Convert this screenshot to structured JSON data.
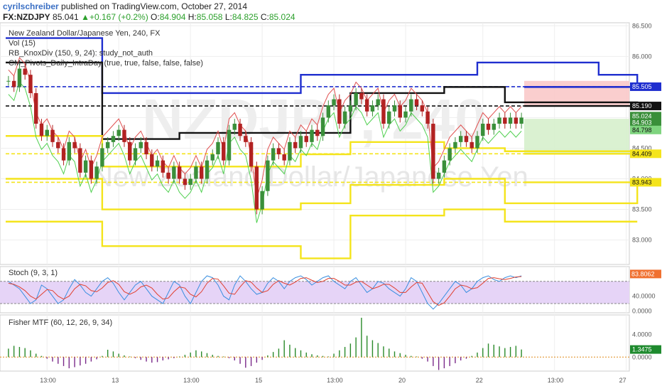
{
  "header": {
    "author": "cyrilschreiber",
    "published": " published on TradingView.com, October 27, 2014",
    "symbol": "FX:NZDJPY",
    "last": "85.041",
    "change_arrow": "▲",
    "change": "+0.167 (+0.2%)",
    "open_label": "O:",
    "open": "84.904",
    "high_label": "H:",
    "high": "85.058",
    "low_label": "L:",
    "low": "84.825",
    "close_label": "C:",
    "close": "85.024"
  },
  "colors": {
    "up": "#3a8f3a",
    "down": "#b22222",
    "pivot_r": "#1f2ecf",
    "pivot_p": "#111111",
    "pivot_s": "#f4e41b",
    "stoch_k": "#3a8fe0",
    "stoch_d": "#e04030",
    "stoch_band": "#e6d4f7",
    "fisher": "#2a8a2a",
    "fisher_neg": "#7a2a8a",
    "fisher_zero": "#e08a1a",
    "zone_red": "#f9c9c9",
    "zone_green": "#d6f0cc"
  },
  "chart_data": [
    {
      "type": "candlestick",
      "title": "New Zealand Dollar/Japanese Yen, 240, FX",
      "watermark_symbol": "NZDJPY, 240",
      "watermark_name": "New Zealand Dollar/Japanese Yen",
      "indicators": [
        "Vol (15)",
        "RB_KnoxDiv (150, 9, 24): study_not_auth",
        "CM_Pivots_Daily_IntraDay (true, true, false, false, false)"
      ],
      "ylim": [
        82.6,
        86.55
      ],
      "yticks": [
        "86.500",
        "86.000",
        "85.500",
        "85.000",
        "84.500",
        "84.000",
        "83.500",
        "83.000"
      ],
      "ytick_values": [
        86.5,
        86.0,
        85.5,
        85.0,
        84.5,
        84.0,
        83.5,
        83.0
      ],
      "xticks": [
        "13:00",
        "13",
        "13:00",
        "15",
        "13:00",
        "20",
        "22",
        "13:00",
        "27"
      ],
      "xtick_bars": [
        7,
        20,
        33,
        46,
        59,
        72,
        86,
        99,
        112
      ],
      "price_tags": [
        {
          "label": "85.505",
          "value": 85.505,
          "bg": "#1f2ecf",
          "fg": "#ffffff"
        },
        {
          "label": "85.190",
          "value": 85.19,
          "bg": "#111111",
          "fg": "#ffffff"
        },
        {
          "label": "85.024",
          "value": 85.024,
          "bg": "#3a8f3a",
          "fg": "#ffffff"
        },
        {
          "label": "84.903",
          "value": 84.92,
          "bg": "#3a8f3a",
          "fg": "#ffffff"
        },
        {
          "label": "84.798",
          "value": 84.798,
          "bg": "#7fd47f",
          "fg": "#111111"
        },
        {
          "label": "84.409",
          "value": 84.409,
          "bg": "#f4e41b",
          "fg": "#111111"
        },
        {
          "label": "83.943",
          "value": 83.943,
          "bg": "#f4e41b",
          "fg": "#111111"
        }
      ],
      "closes": [
        85.6,
        85.5,
        85.8,
        85.7,
        85.4,
        84.9,
        84.7,
        84.8,
        84.6,
        84.5,
        84.3,
        84.6,
        84.5,
        84.1,
        84.3,
        84.0,
        84.2,
        84.5,
        84.6,
        84.7,
        84.8,
        84.6,
        84.3,
        84.5,
        84.6,
        84.4,
        84.2,
        84.3,
        84.1,
        84.0,
        84.2,
        84.0,
        83.9,
        84.0,
        84.2,
        84.0,
        84.3,
        84.4,
        84.6,
        84.3,
        84.8,
        84.9,
        84.7,
        84.6,
        84.2,
        83.5,
        83.8,
        84.3,
        84.5,
        84.4,
        84.3,
        84.6,
        84.5,
        84.7,
        84.6,
        84.8,
        84.7,
        85.0,
        85.2,
        85.3,
        84.9,
        85.1,
        85.2,
        85.4,
        85.3,
        85.1,
        85.2,
        85.3,
        84.9,
        85.1,
        85.2,
        85.0,
        85.1,
        85.3,
        85.2,
        85.1,
        84.9,
        84.0,
        84.1,
        84.3,
        84.5,
        84.6,
        84.7,
        84.6,
        84.5,
        84.7,
        84.9,
        84.8,
        84.9,
        85.0,
        84.9,
        85.0,
        84.9,
        85.0
      ],
      "pivot_lines": [
        {
          "name": "R1",
          "style": "solid",
          "color": "#1f2ecf",
          "steps": [
            [
              0,
              86.3
            ],
            [
              17,
              85.4
            ],
            [
              31,
              85.4
            ],
            [
              53,
              85.7
            ],
            [
              73,
              85.7
            ],
            [
              85,
              85.9
            ],
            [
              107,
              85.7
            ],
            [
              114,
              85.5
            ]
          ]
        },
        {
          "name": "R1 dashed",
          "style": "dashed",
          "color": "#1f2ecf",
          "steps": [
            [
              0,
              85.505
            ],
            [
              114,
              85.505
            ]
          ]
        },
        {
          "name": "P",
          "style": "solid",
          "color": "#111111",
          "steps": [
            [
              0,
              85.9
            ],
            [
              17,
              84.65
            ],
            [
              31,
              84.75
            ],
            [
              53,
              84.75
            ],
            [
              62,
              85.4
            ],
            [
              73,
              85.4
            ],
            [
              79,
              85.5
            ],
            [
              90,
              85.25
            ],
            [
              107,
              85.25
            ],
            [
              114,
              85.19
            ]
          ]
        },
        {
          "name": "P dashed",
          "style": "dashed",
          "color": "#111111",
          "steps": [
            [
              0,
              85.19
            ],
            [
              114,
              85.19
            ]
          ]
        },
        {
          "name": "S1",
          "style": "solid",
          "color": "#f4e41b",
          "steps": [
            [
              0,
              84.7
            ],
            [
              17,
              84.2
            ],
            [
              31,
              84.2
            ],
            [
              53,
              84.4
            ],
            [
              62,
              84.6
            ],
            [
              73,
              84.6
            ],
            [
              79,
              84.5
            ],
            [
              90,
              84.45
            ],
            [
              107,
              84.45
            ],
            [
              114,
              84.409
            ]
          ]
        },
        {
          "name": "S1 dashed",
          "style": "dashed",
          "color": "#f4e41b",
          "steps": [
            [
              0,
              84.409
            ],
            [
              114,
              84.409
            ]
          ]
        },
        {
          "name": "S2",
          "style": "solid",
          "color": "#f4e41b",
          "steps": [
            [
              0,
              84.0
            ],
            [
              17,
              83.5
            ],
            [
              31,
              83.5
            ],
            [
              53,
              83.6
            ],
            [
              62,
              83.9
            ],
            [
              73,
              83.9
            ],
            [
              79,
              84.0
            ],
            [
              90,
              83.6
            ],
            [
              107,
              83.6
            ],
            [
              114,
              83.943
            ]
          ]
        },
        {
          "name": "S2 dashed",
          "style": "dashed",
          "color": "#f4e41b",
          "steps": [
            [
              0,
              83.943
            ],
            [
              114,
              83.943
            ]
          ]
        },
        {
          "name": "S3",
          "style": "solid",
          "color": "#f4e41b",
          "steps": [
            [
              0,
              83.3
            ],
            [
              17,
              82.9
            ],
            [
              31,
              82.9
            ],
            [
              53,
              82.7
            ],
            [
              62,
              83.4
            ],
            [
              73,
              83.4
            ],
            [
              79,
              83.5
            ],
            [
              90,
              83.3
            ],
            [
              107,
              83.3
            ],
            [
              114,
              83.3
            ]
          ]
        }
      ]
    },
    {
      "type": "line",
      "title": "Stoch (9, 3, 1)",
      "ylim": [
        -5,
        120
      ],
      "yticks": [
        "40.0000",
        "0.0000"
      ],
      "ytick_values": [
        40,
        0
      ],
      "band": [
        20,
        80
      ],
      "tag": {
        "label": "83.8062",
        "value": 83.8062
      },
      "series": [
        {
          "name": "%K",
          "values": [
            80,
            70,
            60,
            40,
            20,
            30,
            70,
            60,
            40,
            20,
            30,
            60,
            85,
            70,
            50,
            40,
            60,
            80,
            90,
            75,
            50,
            30,
            50,
            70,
            80,
            60,
            40,
            30,
            20,
            50,
            80,
            70,
            40,
            20,
            50,
            80,
            95,
            90,
            70,
            40,
            30,
            70,
            95,
            80,
            60,
            45,
            50,
            75,
            90,
            80,
            60,
            80,
            90,
            95,
            85,
            70,
            80,
            90,
            95,
            80,
            70,
            60,
            80,
            90,
            70,
            50,
            60,
            80,
            75,
            60,
            50,
            40,
            60,
            90,
            80,
            50,
            20,
            5,
            20,
            40,
            60,
            80,
            70,
            50,
            60,
            80,
            90,
            95,
            85,
            80,
            90,
            95,
            90,
            95
          ]
        },
        {
          "name": "%D",
          "values": [
            75,
            72,
            65,
            55,
            40,
            32,
            45,
            58,
            55,
            40,
            32,
            40,
            60,
            72,
            68,
            55,
            52,
            62,
            77,
            82,
            72,
            52,
            45,
            52,
            65,
            70,
            62,
            45,
            32,
            35,
            52,
            65,
            62,
            45,
            38,
            52,
            75,
            88,
            86,
            68,
            48,
            45,
            65,
            82,
            78,
            62,
            50,
            55,
            72,
            82,
            75,
            70,
            78,
            88,
            90,
            83,
            77,
            80,
            88,
            88,
            80,
            70,
            70,
            78,
            80,
            70,
            60,
            65,
            72,
            72,
            62,
            50,
            50,
            65,
            77,
            75,
            50,
            25,
            15,
            22,
            40,
            60,
            70,
            67,
            60,
            63,
            75,
            88,
            90,
            87,
            85,
            88,
            92,
            93
          ]
        }
      ]
    },
    {
      "type": "bar",
      "title": "Fisher MTF (60, 12, 26, 9, 34)",
      "ylim": [
        -2.5,
        7.5
      ],
      "yticks": [
        "4.0000",
        "0.0000"
      ],
      "ytick_values": [
        4,
        0
      ],
      "tag": {
        "label": "1.3475",
        "value": 1.3475
      },
      "values": [
        1.5,
        2.0,
        1.8,
        1.6,
        1.2,
        0.6,
        0.2,
        -0.3,
        -0.8,
        -1.2,
        -1.6,
        -2.0,
        -1.8,
        -1.5,
        -1.2,
        -0.8,
        -0.4,
        0.2,
        1.3,
        1.0,
        0.6,
        0.3,
        0.1,
        -0.2,
        -0.5,
        -0.8,
        -1.0,
        -0.9,
        -0.6,
        -0.4,
        -0.2,
        0.1,
        0.4,
        0.8,
        1.2,
        1.0,
        0.7,
        0.4,
        0.2,
        0.1,
        -0.2,
        -0.6,
        -1.2,
        -1.9,
        -1.6,
        -1.0,
        -0.5,
        0.3,
        0.9,
        1.5,
        3.0,
        2.2,
        1.6,
        1.2,
        0.8,
        0.5,
        0.3,
        0.2,
        0.1,
        0.6,
        1.2,
        1.8,
        2.4,
        3.5,
        7.0,
        3.8,
        3.0,
        2.5,
        1.9,
        1.5,
        1.0,
        0.7,
        0.4,
        0.2,
        0.1,
        -0.3,
        -0.8,
        -1.6,
        -2.3,
        -2.0,
        -1.6,
        -1.1,
        -0.6,
        -0.3,
        0.2,
        0.8,
        1.6,
        2.4,
        2.2,
        1.9,
        1.6,
        1.8,
        2.0,
        1.3475
      ]
    }
  ]
}
